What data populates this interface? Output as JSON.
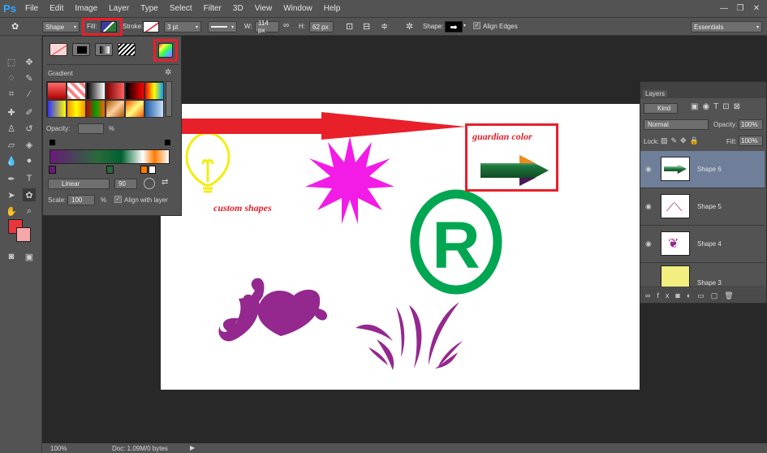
{
  "app": {
    "logo": "Ps"
  },
  "menu": [
    "File",
    "Edit",
    "Image",
    "Layer",
    "Type",
    "Select",
    "Filter",
    "3D",
    "View",
    "Window",
    "Help"
  ],
  "window_buttons": {
    "minimize": "—",
    "restore": "❐",
    "close": "✕"
  },
  "options": {
    "tool_mode": "Shape",
    "fill_label": "Fill:",
    "stroke_label": "Stroke:",
    "stroke_width": "3 pt",
    "w_label": "W:",
    "w_value": "114 px",
    "h_label": "H:",
    "h_value": "62 px",
    "shape_label": "Shape:",
    "align_edges": "Align Edges",
    "workspace": "Essentials"
  },
  "fill_panel": {
    "gradient_label": "Gradient",
    "opacity_label": "Opacity:",
    "opacity_unit": "%",
    "style": "Linear",
    "angle": "90",
    "scale_label": "Scale:",
    "scale_value": "100",
    "scale_unit": "%",
    "align_with_layer": "Align with layer",
    "gradient_swatches": [
      "linear-gradient(180deg,#ff6a6a,#b30000)",
      "repeating-linear-gradient(45deg,#ff8080 0 4px,#ffffff 4px 8px)",
      "linear-gradient(90deg,#000,#fff)",
      "linear-gradient(90deg,#7a0000,#ff6060)",
      "linear-gradient(90deg,#000,#ff0000)",
      "linear-gradient(90deg,#ff0000,#ffff00,#00a0ff)",
      "linear-gradient(90deg,#3030ff,#ffff00)",
      "linear-gradient(90deg,#ff9000,#ffff00,#ff9000)",
      "linear-gradient(90deg,#d00000,#00a000,#ff6000)",
      "linear-gradient(135deg,#aa5500,#ffd0a0,#aa5500)",
      "linear-gradient(135deg,#ff5000,#ffff80,#ff5000)",
      "linear-gradient(90deg,#1e5aa0,#c8e0ff)"
    ],
    "gradient_bar": "linear-gradient(90deg,#6a1a7a 0%,#2a6a3a 40%,#006030 60%,#ffffff 78%,#ff7a00 88%,#ffffff 100%)"
  },
  "layers": {
    "tab": "Layers",
    "kind": "Kind",
    "blend_mode": "Normal",
    "opacity_label": "Opacity:",
    "opacity_value": "100%",
    "lock_label": "Lock:",
    "fill_label": "Fill:",
    "fill_value": "100%",
    "items": [
      {
        "name": "Shape 6",
        "selected": true
      },
      {
        "name": "Shape 5",
        "selected": false
      },
      {
        "name": "Shape 4",
        "selected": false
      },
      {
        "name": "Shape 3",
        "selected": false
      }
    ]
  },
  "annotations": {
    "custom_shapes": "custom shapes",
    "guardian_color": "guardian color"
  },
  "status": {
    "zoom": "100%",
    "doc": "Doc: 1.09M/0 bytes"
  },
  "colors": {
    "foreground": "#e8373c",
    "background": "#f5a7a9",
    "accent_red": "#e8202a"
  }
}
